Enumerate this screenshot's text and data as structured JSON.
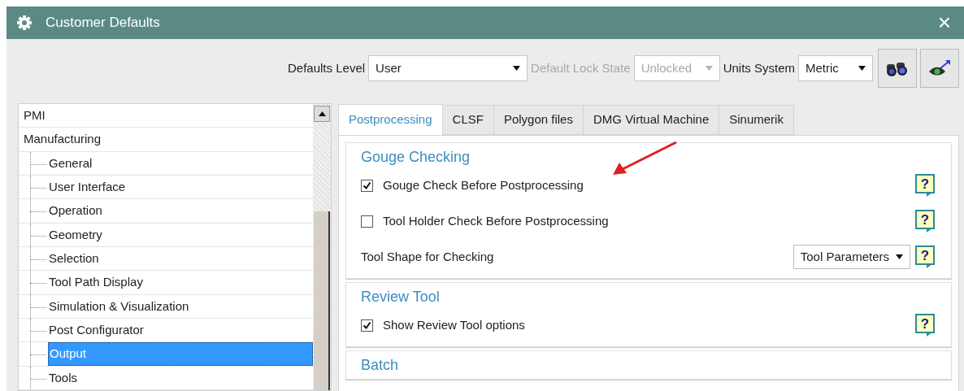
{
  "window": {
    "title": "Customer Defaults",
    "close": "×"
  },
  "toolbar": {
    "defaults_level": {
      "label": "Defaults Level",
      "value": "User",
      "disabled": false
    },
    "lock_state": {
      "label": "Default Lock State",
      "value": "Unlocked",
      "disabled": true
    },
    "units_system": {
      "label": "Units System",
      "value": "Metric",
      "disabled": false
    }
  },
  "tree": [
    {
      "label": "PMI",
      "selected": false
    },
    {
      "label": "Manufacturing",
      "selected": false,
      "children": [
        {
          "label": "General",
          "selected": false
        },
        {
          "label": "User Interface",
          "selected": false
        },
        {
          "label": "Operation",
          "selected": false
        },
        {
          "label": "Geometry",
          "selected": false
        },
        {
          "label": "Selection",
          "selected": false
        },
        {
          "label": "Tool Path Display",
          "selected": false
        },
        {
          "label": "Simulation & Visualization",
          "selected": false
        },
        {
          "label": "Post Configurator",
          "selected": false
        },
        {
          "label": "Output",
          "selected": true
        },
        {
          "label": "Tools",
          "selected": false
        }
      ]
    }
  ],
  "tabs": [
    {
      "label": "Postprocessing",
      "selected": true
    },
    {
      "label": "CLSF",
      "selected": false
    },
    {
      "label": "Polygon files",
      "selected": false
    },
    {
      "label": "DMG Virtual Machine",
      "selected": false
    },
    {
      "label": "Sinumerik",
      "selected": false
    }
  ],
  "sections": [
    {
      "title": "Gouge Checking",
      "rows": [
        {
          "kind": "checkbox",
          "label": "Gouge Check Before Postprocessing",
          "checked": true,
          "help": "?"
        },
        {
          "kind": "checkbox",
          "label": "Tool Holder Check Before Postprocessing",
          "checked": false,
          "help": "?"
        },
        {
          "kind": "select",
          "label": "Tool Shape for Checking",
          "value": "Tool Parameters",
          "help": "?"
        }
      ]
    },
    {
      "title": "Review Tool",
      "rows": [
        {
          "kind": "checkbox",
          "label": "Show Review Tool options",
          "checked": true,
          "help": "?"
        }
      ]
    },
    {
      "title": "Batch"
    }
  ]
}
